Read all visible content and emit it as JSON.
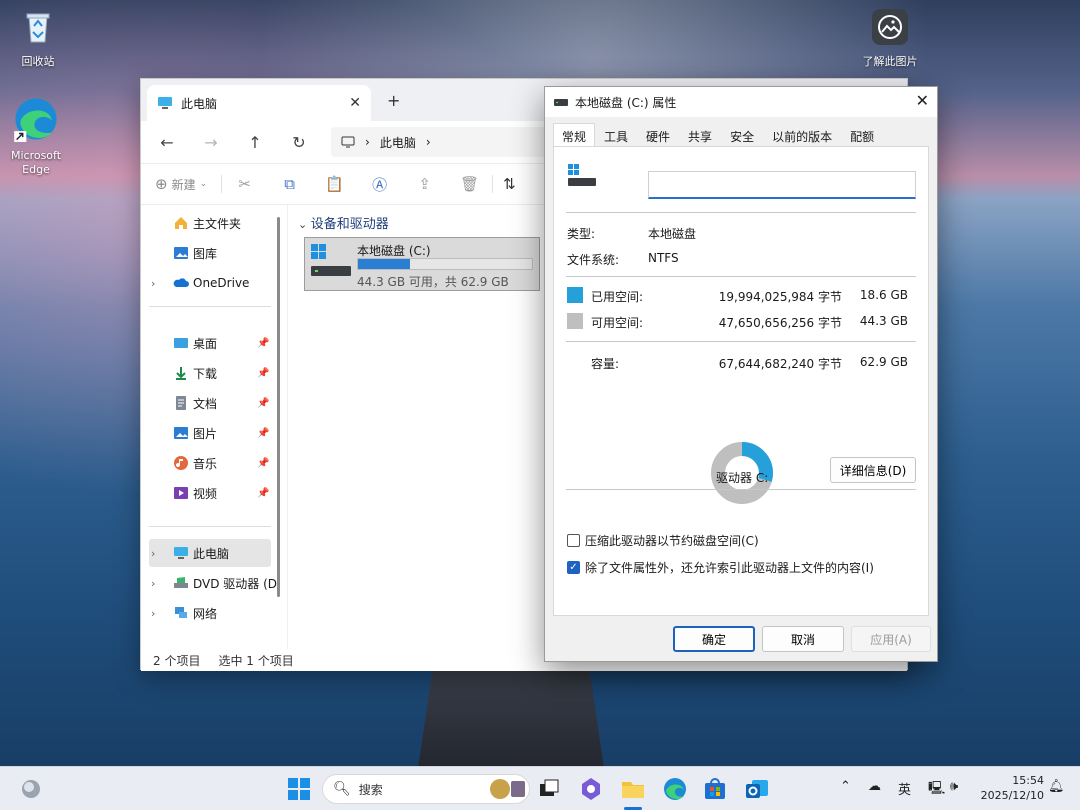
{
  "desktop": {
    "icons": [
      {
        "label": "回收站"
      },
      {
        "label": "Microsoft\nEdge"
      },
      {
        "label": "了解此图片"
      }
    ]
  },
  "explorer": {
    "tab_title": "此电脑",
    "breadcrumb": "此电脑",
    "toolbar": {
      "new_label": "新建"
    },
    "sidebar": {
      "home": "主文件夹",
      "gallery": "图库",
      "onedrive": "OneDrive",
      "quick": [
        "桌面",
        "下载",
        "文档",
        "图片",
        "音乐",
        "视频"
      ],
      "this_pc": "此电脑",
      "dvd": "DVD 驱动器 (D",
      "network": "网络"
    },
    "group_title": "设备和驱动器",
    "drive": {
      "name": "本地磁盘 (C:)",
      "info": "44.3 GB 可用，共 62.9 GB",
      "used_fraction": 0.296
    },
    "status": {
      "count": "2 个项目",
      "selected": "选中 1 个项目"
    }
  },
  "dialog": {
    "title": "本地磁盘 (C:) 属性",
    "tabs": [
      "常规",
      "工具",
      "硬件",
      "共享",
      "安全",
      "以前的版本",
      "配额"
    ],
    "name_value": "",
    "type_label": "类型:",
    "type_value": "本地磁盘",
    "fs_label": "文件系统:",
    "fs_value": "NTFS",
    "used_label": "已用空间:",
    "used_bytes": "19,994,025,984 字节",
    "used_gb": "18.6 GB",
    "free_label": "可用空间:",
    "free_bytes": "47,650,656,256 字节",
    "free_gb": "44.3 GB",
    "cap_label": "容量:",
    "cap_bytes": "67,644,682,240 字节",
    "cap_gb": "62.9 GB",
    "drive_label": "驱动器 C:",
    "details_button": "详细信息(D)",
    "compress_label": "压缩此驱动器以节约磁盘空间(C)",
    "compress_checked": false,
    "index_label": "除了文件属性外，还允许索引此驱动器上文件的内容(I)",
    "index_checked": true,
    "ok": "确定",
    "cancel": "取消",
    "apply": "应用(A)",
    "colors": {
      "used": "#26a0da",
      "free": "#bfbfbf"
    },
    "used_fraction": 0.296
  },
  "taskbar": {
    "search_placeholder": "搜索",
    "ime": "英",
    "time": "15:54",
    "date": "2025/12/10"
  }
}
